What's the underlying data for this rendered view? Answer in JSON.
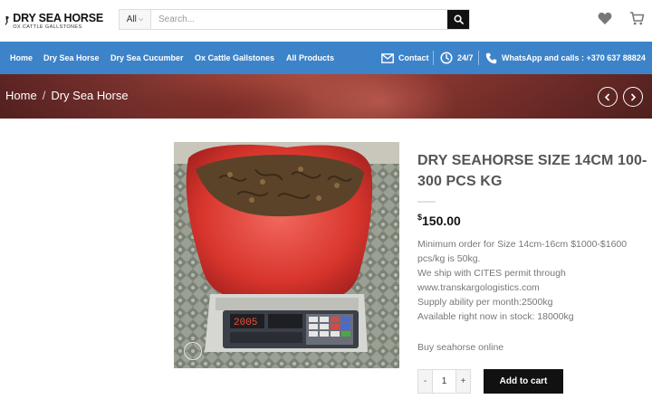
{
  "brand": {
    "title": "DRY SEA HORSE",
    "subtitle": "OX CATTLE GALLSTONES"
  },
  "search": {
    "category": "All",
    "placeholder": "Search..."
  },
  "nav": {
    "items": [
      "Home",
      "Dry Sea Horse",
      "Dry Sea Cucumber",
      "Ox Cattle Gallstones",
      "All Products"
    ],
    "contact": "Contact",
    "hours": "24/7",
    "whatsapp": "WhatsApp and calls : +370 637 88824"
  },
  "breadcrumb": [
    "Home",
    "Dry Sea Horse"
  ],
  "product": {
    "title": "DRY SEAHORSE SIZE 14CM 100-300 PCS KG",
    "currency": "$",
    "price": "150.00",
    "description": [
      "Minimum order for Size 14cm-16cm  $1000-$1600",
      "pcs/kg  is 50kg.",
      "We ship with CITES permit through",
      "www.transkargologistics.com",
      "Supply ability per month:2500kg",
      "Available right now in stock: 18000kg"
    ],
    "buy_text": "Buy seahorse online",
    "quantity": "1",
    "qty_minus": "-",
    "qty_plus": "+",
    "add_to_cart": "Add to cart",
    "scale_display": "2005"
  },
  "colors": {
    "nav_bg": "#3d83c9",
    "button_bg": "#111111"
  }
}
